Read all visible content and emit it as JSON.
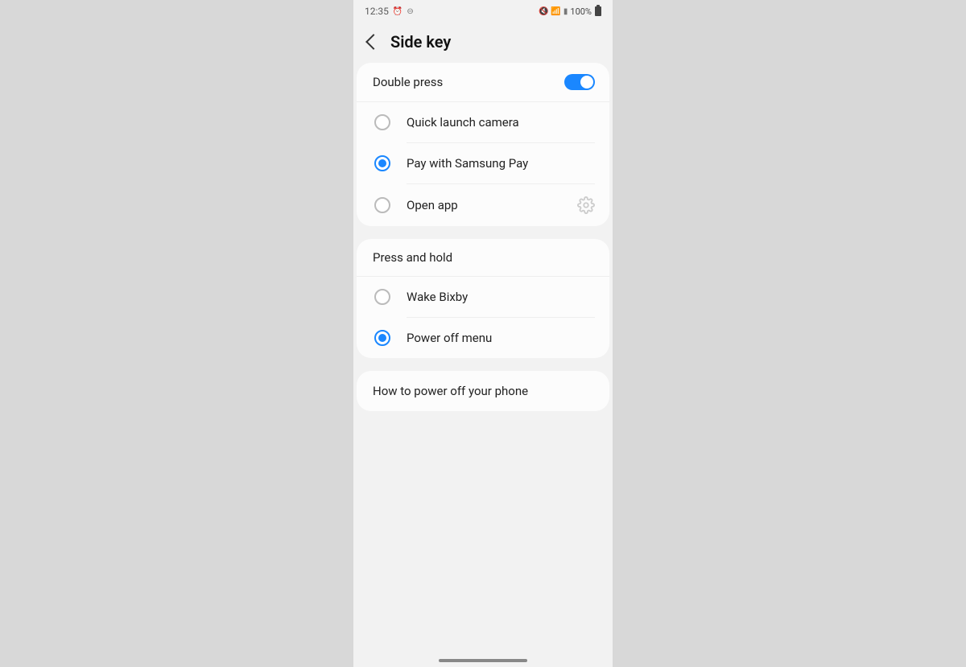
{
  "statusBar": {
    "time": "12:35",
    "battery": "100%"
  },
  "header": {
    "title": "Side key"
  },
  "doublePress": {
    "title": "Double press",
    "toggleOn": true,
    "options": [
      {
        "label": "Quick launch camera",
        "selected": false,
        "hasGear": false
      },
      {
        "label": "Pay with Samsung Pay",
        "selected": true,
        "hasGear": false
      },
      {
        "label": "Open app",
        "selected": false,
        "hasGear": true
      }
    ]
  },
  "pressHold": {
    "title": "Press and hold",
    "options": [
      {
        "label": "Wake Bixby",
        "selected": false
      },
      {
        "label": "Power off menu",
        "selected": true
      }
    ]
  },
  "howTo": {
    "label": "How to power off your phone"
  }
}
